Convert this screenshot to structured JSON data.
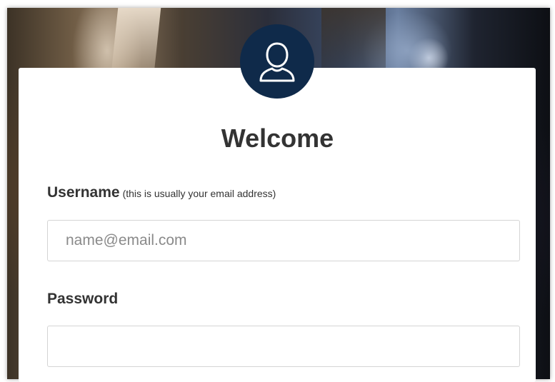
{
  "login": {
    "title": "Welcome",
    "username_label": "Username",
    "username_hint": "(this is usually your email address)",
    "username_placeholder": "name@email.com",
    "password_label": "Password",
    "password_placeholder": ""
  },
  "icons": {
    "avatar": "user-icon"
  },
  "colors": {
    "avatar_bg": "#0f2a4a",
    "card_bg": "#ffffff",
    "text": "#333333",
    "input_border": "#d4d4d4"
  }
}
